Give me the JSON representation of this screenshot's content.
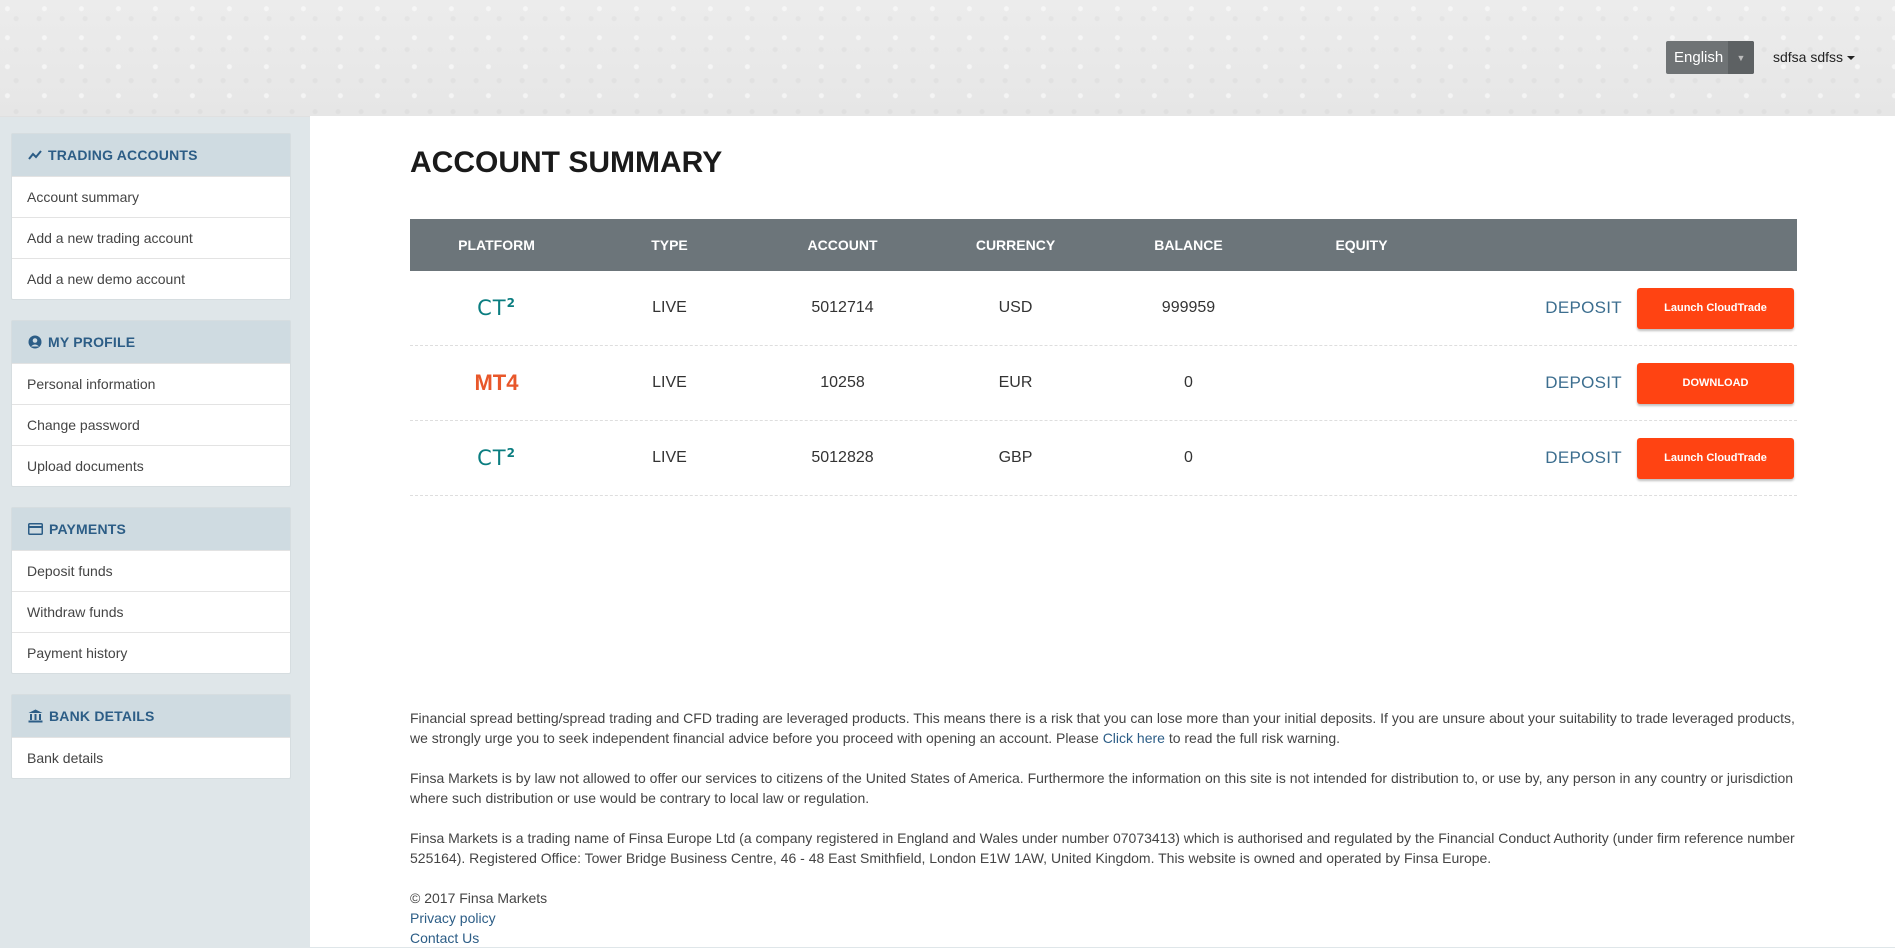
{
  "header": {
    "language": "English",
    "user_name": "sdfsa sdfss"
  },
  "sidebar": {
    "sections": [
      {
        "title": "TRADING ACCOUNTS",
        "icon": "chart-line-icon",
        "items": [
          "Account summary",
          "Add a new trading account",
          "Add a new demo account"
        ]
      },
      {
        "title": "MY PROFILE",
        "icon": "user-circle-icon",
        "items": [
          "Personal information",
          "Change password",
          "Upload documents"
        ]
      },
      {
        "title": "PAYMENTS",
        "icon": "credit-card-icon",
        "items": [
          "Deposit funds",
          "Withdraw funds",
          "Payment history"
        ]
      },
      {
        "title": "BANK DETAILS",
        "icon": "bank-icon",
        "items": [
          "Bank details"
        ]
      }
    ]
  },
  "main": {
    "title": "ACCOUNT SUMMARY",
    "table": {
      "headers": [
        "PLATFORM",
        "TYPE",
        "ACCOUNT",
        "CURRENCY",
        "BALANCE",
        "EQUITY"
      ],
      "rows": [
        {
          "platform": "CT",
          "platform_sup": "2",
          "type": "LIVE",
          "account": "5012714",
          "currency": "USD",
          "balance": "999959",
          "equity": "",
          "deposit": "DEPOSIT",
          "action": "Launch CloudTrade"
        },
        {
          "platform": "MT",
          "platform_sup": "4",
          "type": "LIVE",
          "account": "10258",
          "currency": "EUR",
          "balance": "0",
          "equity": "",
          "deposit": "DEPOSIT",
          "action": "DOWNLOAD"
        },
        {
          "platform": "CT",
          "platform_sup": "2",
          "type": "LIVE",
          "account": "5012828",
          "currency": "GBP",
          "balance": "0",
          "equity": "",
          "deposit": "DEPOSIT",
          "action": "Launch CloudTrade"
        }
      ]
    }
  },
  "footer": {
    "risk_text_1": "Financial spread betting/spread trading and CFD trading are leveraged products. This means there is a risk that you can lose more than your initial deposits. If you are unsure about your suitability to trade leveraged products, we strongly urge you to seek independent financial advice before you proceed with opening an account. Please ",
    "risk_link": "Click here",
    "risk_text_2": " to read the full risk warning.",
    "us_notice": "Finsa Markets is by law not allowed to offer our services to citizens of the United States of America. Furthermore the information on this site is not intended for distribution to, or use by, any person in any country or jurisdiction where such distribution or use would be contrary to local law or regulation.",
    "legal": "Finsa Markets is a trading name of Finsa Europe Ltd (a company registered in England and Wales under number 07073413) which is authorised and regulated by the Financial Conduct Authority (under firm reference number 525164). Registered Office: Tower Bridge Business Centre, 46 - 48 East Smithfield, London E1W 1AW, United Kingdom. This website is owned and operated by Finsa Europe.",
    "copyright": "© 2017 Finsa Markets",
    "privacy": "Privacy policy",
    "contact": "Contact Us"
  }
}
